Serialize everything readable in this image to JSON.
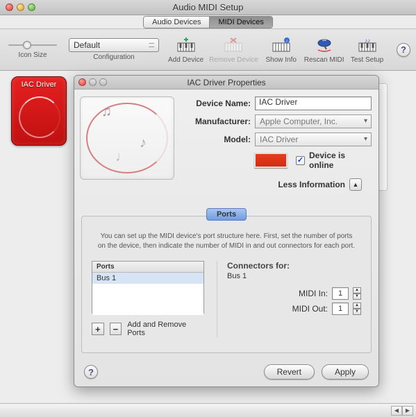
{
  "window_title": "Audio MIDI Setup",
  "tabs": {
    "audio": "Audio Devices",
    "midi": "MIDI Devices"
  },
  "toolbar": {
    "icon_size": "Icon Size",
    "configuration_label": "Configuration",
    "configuration_value": "Default",
    "add_device": "Add Device",
    "remove_device": "Remove Device",
    "show_info": "Show Info",
    "rescan_midi": "Rescan MIDI",
    "test_setup": "Test Setup",
    "help": "?"
  },
  "iac_card_title": "IAC Driver",
  "sheet": {
    "title": "IAC Driver Properties",
    "labels": {
      "device_name": "Device Name:",
      "manufacturer": "Manufacturer:",
      "model": "Model:",
      "device_online": "Device is online",
      "less_info": "Less Information"
    },
    "values": {
      "device_name": "IAC Driver",
      "manufacturer": "Apple Computer, Inc.",
      "model": "IAC Driver"
    },
    "color": "#e63c20",
    "device_online_checked": true,
    "ports": {
      "tab": "Ports",
      "description1": "You can set up the MIDI device's port structure here.  First, set the number of ports",
      "description2": "on the device, then indicate the number of MIDI in and out connectors for each port.",
      "list_header": "Ports",
      "items": [
        "Bus 1"
      ],
      "add_remove_label": "Add and Remove Ports"
    },
    "connectors": {
      "header": "Connectors for:",
      "bus": "Bus 1",
      "midi_in_label": "MIDI In:",
      "midi_in_value": "1",
      "midi_out_label": "MIDI Out:",
      "midi_out_value": "1"
    },
    "buttons": {
      "revert": "Revert",
      "apply": "Apply"
    }
  }
}
